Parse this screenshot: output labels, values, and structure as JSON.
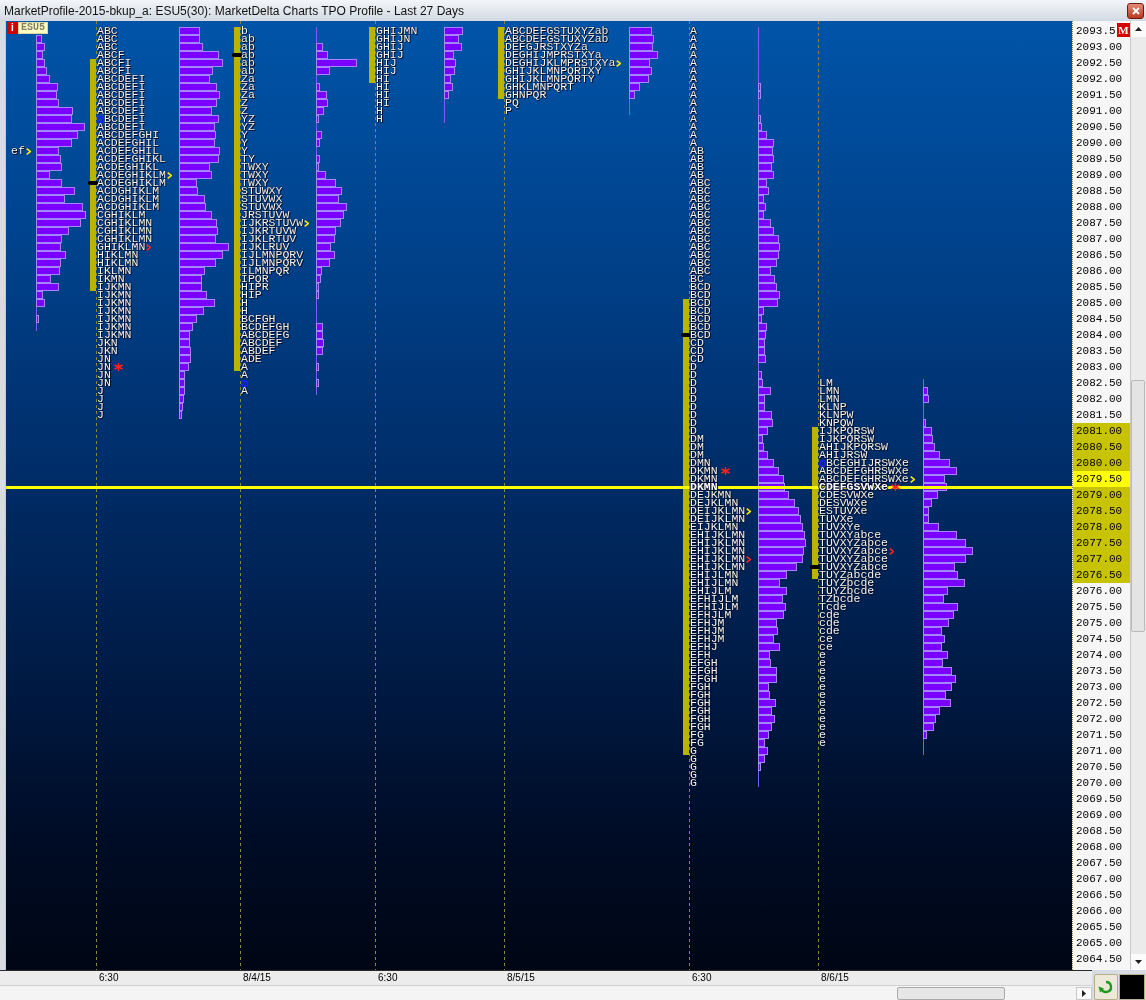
{
  "window": {
    "title": "MarketProfile-2015-bkup_a: ESU5(30): MarketDelta Charts TPO Profile - Last 27 Days"
  },
  "chart": {
    "info_badge": "i",
    "symbol": "ESU5",
    "sessions": [
      {
        "rows": [
          "ef"
        ]
      },
      {
        "time_label": "6:30",
        "rows": [
          "ABC",
          "ABC",
          "ABC",
          "ABCF",
          "ABCFI",
          "ABCFI",
          "ABCDEFI",
          "ABCDEFI",
          "ABCDEFI",
          "ABCDEFI",
          "ABCDEFI",
          "BCDEFI",
          "ABCDEFI",
          "ABCDEFGHI",
          "ACDEFGHIL",
          "ACDEFGHIL",
          "ACDEFGHIKL",
          "ACDEGHIKL",
          "ACDEGHIKLM",
          "ACDEGHIKLM",
          "ACDGHIKLM",
          "ACDGHIKLM",
          "ACDGHIKLM",
          "CGHIKLM",
          "CGHIKLMN",
          "CGHIKLMN",
          "CGHIKLMN",
          "GHIKLMN",
          "HIKLMN",
          "HIKLMN",
          "IKLMN",
          "IKMN",
          "IJKMN",
          "IJKMN",
          "IJKMN",
          "IJKMN",
          "IJKMN",
          "IJKMN",
          "IJKMN",
          "JKN",
          "JKN",
          "JN",
          "JN",
          "JN",
          "JN",
          "J",
          "J",
          "J",
          "J"
        ]
      },
      {
        "time_label": "8/4/15",
        "rows": [
          "b",
          "ab",
          "ab",
          "ab",
          "ab",
          "ab",
          "Za",
          "Za",
          "Za",
          "Z",
          "Z",
          "YZ",
          "YZ",
          "Y",
          "Y",
          "Y",
          "TY",
          "TWXY",
          "TWXY",
          "TWXY",
          "STUWXY",
          "STUVWX",
          "STUVWX",
          "JRSTUVW",
          "IJKRSTUVW",
          "IJKRTUVW",
          "IJKLRTUV",
          "IJKLRUV",
          "IJLMNPQRV",
          "IJLMNPQRV",
          "ILMNPQR",
          "IPQR",
          "HIPR",
          "HIP",
          "H",
          "H",
          "BCFGH",
          "BCDEFGH",
          "ABCDEFG",
          "ABCDEF",
          "ABDEF",
          "ADE",
          "A",
          "A",
          null,
          "A"
        ]
      },
      {
        "time_label": "6:30",
        "rows": [
          "GHIJMN",
          "GHIJN",
          "GHIJ",
          "GHIJ",
          "HIJ",
          "HIJ",
          "HI",
          "HI",
          "HI",
          "HI",
          "H",
          "H"
        ]
      },
      {
        "time_label": "8/5/15",
        "rows": [
          "ABCDEFGSTUXYZab",
          "ABCDEFGSTUXYZab",
          "DEFGJRSTXYZa",
          "DEGHIJMPRSTXYa",
          "DEGHIJKLMPRSTXYa",
          "GHIJKLMNPQRTXY",
          "GHIJKLMNPQRTY",
          "GHKLMNPQRT",
          "GHNPQR",
          "PQ",
          "P"
        ]
      },
      {
        "time_label": "6:30",
        "rows": [
          "A",
          "A",
          "A",
          "A",
          "A",
          "A",
          "A",
          "A",
          "A",
          "A",
          "A",
          "A",
          "A",
          "A",
          "A",
          "AB",
          "AB",
          "AB",
          "AB",
          "ABC",
          "ABC",
          "ABC",
          "ABC",
          "ABC",
          "ABC",
          "ABC",
          "ABC",
          "ABC",
          "ABC",
          "ABC",
          "ABC",
          "BC",
          "BCD",
          "BCD",
          "BCD",
          "BCD",
          "BCD",
          "BCD",
          "BCD",
          "CD",
          "CD",
          "CD",
          "D",
          "D",
          "D",
          "D",
          "D",
          "D",
          "D",
          "D",
          "D",
          "DM",
          "DM",
          "DM",
          "DMN",
          "DKMN",
          "DKMN",
          "DKMN",
          "DEJKMN",
          "DEJKLMN",
          "DEIJKLMN",
          "DEIJKLMN",
          "EIJKLMN",
          "EHIJKLMN",
          "EHIJKLMN",
          "EHIJKLMN",
          "EHIJKLMN",
          "EHIJKLMN",
          "EHIJLMN",
          "EHIJLMN",
          "EHIJLM",
          "EFHIJLM",
          "EFHIJLM",
          "EFHJLM",
          "EFHJM",
          "EFHJM",
          "EFHJM",
          "EFHJ",
          "EFH",
          "EFGH",
          "EFGH",
          "EFGH",
          "FGH",
          "FGH",
          "FGH",
          "FGH",
          "FGH",
          "FGH",
          "FG",
          "FG",
          "G",
          "G",
          "G",
          "G",
          "G"
        ]
      },
      {
        "time_label": "8/6/15",
        "rows": [
          "LM",
          "LMN",
          "LMN",
          "KLNP",
          "KLNPW",
          "KNPQW",
          "IJKPQRSW",
          "IJKPQRSW",
          "AHIJKPQRSW",
          "AHIJRSW",
          "BCEGHIJRSWXe",
          "ABCDEFGHRSWXe",
          "ABCDEFGHRSWXe",
          "CDEFGSVWXe",
          "CDESVWXe",
          "DESVWXe",
          "ESTUVXe",
          "TUVXe",
          "TUVXYe",
          "TUVXYabce",
          "TUVXYZabce",
          "TUVXYZabce",
          "TUVXYZabce",
          "TUVXYZabce",
          "TUYZabcde",
          "TUYZbcde",
          "TUYZbcde",
          "TZbcde",
          "Tcde",
          "cde",
          "cde",
          "cde",
          "ce",
          "ce",
          "e",
          "e",
          "e",
          "e",
          "e",
          "e",
          "e",
          "e",
          "e",
          "e",
          "e",
          "e"
        ]
      }
    ]
  },
  "price_axis": {
    "mode_badge": "M",
    "labels": [
      {
        "label": "2093.5",
        "in_value_area": false,
        "current": false
      },
      {
        "label": "2093.00",
        "in_value_area": false,
        "current": false
      },
      {
        "label": "2092.50",
        "in_value_area": false,
        "current": false
      },
      {
        "label": "2092.00",
        "in_value_area": false,
        "current": false
      },
      {
        "label": "2091.50",
        "in_value_area": false,
        "current": false
      },
      {
        "label": "2091.00",
        "in_value_area": false,
        "current": false
      },
      {
        "label": "2090.50",
        "in_value_area": false,
        "current": false
      },
      {
        "label": "2090.00",
        "in_value_area": false,
        "current": false
      },
      {
        "label": "2089.50",
        "in_value_area": false,
        "current": false
      },
      {
        "label": "2089.00",
        "in_value_area": false,
        "current": false
      },
      {
        "label": "2088.50",
        "in_value_area": false,
        "current": false
      },
      {
        "label": "2088.00",
        "in_value_area": false,
        "current": false
      },
      {
        "label": "2087.50",
        "in_value_area": false,
        "current": false
      },
      {
        "label": "2087.00",
        "in_value_area": false,
        "current": false
      },
      {
        "label": "2086.50",
        "in_value_area": false,
        "current": false
      },
      {
        "label": "2086.00",
        "in_value_area": false,
        "current": false
      },
      {
        "label": "2085.50",
        "in_value_area": false,
        "current": false
      },
      {
        "label": "2085.00",
        "in_value_area": false,
        "current": false
      },
      {
        "label": "2084.50",
        "in_value_area": false,
        "current": false
      },
      {
        "label": "2084.00",
        "in_value_area": false,
        "current": false
      },
      {
        "label": "2083.50",
        "in_value_area": false,
        "current": false
      },
      {
        "label": "2083.00",
        "in_value_area": false,
        "current": false
      },
      {
        "label": "2082.50",
        "in_value_area": false,
        "current": false
      },
      {
        "label": "2082.00",
        "in_value_area": false,
        "current": false
      },
      {
        "label": "2081.50",
        "in_value_area": false,
        "current": false
      },
      {
        "label": "2081.00",
        "in_value_area": true,
        "current": false
      },
      {
        "label": "2080.50",
        "in_value_area": true,
        "current": false
      },
      {
        "label": "2080.00",
        "in_value_area": true,
        "current": false
      },
      {
        "label": "2079.50",
        "in_value_area": true,
        "current": true
      },
      {
        "label": "2079.00",
        "in_value_area": true,
        "current": false
      },
      {
        "label": "2078.50",
        "in_value_area": true,
        "current": false
      },
      {
        "label": "2078.00",
        "in_value_area": true,
        "current": false
      },
      {
        "label": "2077.50",
        "in_value_area": true,
        "current": false
      },
      {
        "label": "2077.00",
        "in_value_area": true,
        "current": false
      },
      {
        "label": "2076.50",
        "in_value_area": true,
        "current": false
      },
      {
        "label": "2076.00",
        "in_value_area": false,
        "current": false
      },
      {
        "label": "2075.50",
        "in_value_area": false,
        "current": false
      },
      {
        "label": "2075.00",
        "in_value_area": false,
        "current": false
      },
      {
        "label": "2074.50",
        "in_value_area": false,
        "current": false
      },
      {
        "label": "2074.00",
        "in_value_area": false,
        "current": false
      },
      {
        "label": "2073.50",
        "in_value_area": false,
        "current": false
      },
      {
        "label": "2073.00",
        "in_value_area": false,
        "current": false
      },
      {
        "label": "2072.50",
        "in_value_area": false,
        "current": false
      },
      {
        "label": "2072.00",
        "in_value_area": false,
        "current": false
      },
      {
        "label": "2071.50",
        "in_value_area": false,
        "current": false
      },
      {
        "label": "2071.00",
        "in_value_area": false,
        "current": false
      },
      {
        "label": "2070.50",
        "in_value_area": false,
        "current": false
      },
      {
        "label": "2070.00",
        "in_value_area": false,
        "current": false
      },
      {
        "label": "2069.50",
        "in_value_area": false,
        "current": false
      },
      {
        "label": "2069.00",
        "in_value_area": false,
        "current": false
      },
      {
        "label": "2068.50",
        "in_value_area": false,
        "current": false
      },
      {
        "label": "2068.00",
        "in_value_area": false,
        "current": false
      },
      {
        "label": "2067.50",
        "in_value_area": false,
        "current": false
      },
      {
        "label": "2067.00",
        "in_value_area": false,
        "current": false
      },
      {
        "label": "2066.50",
        "in_value_area": false,
        "current": false
      },
      {
        "label": "2066.00",
        "in_value_area": false,
        "current": false
      },
      {
        "label": "2065.50",
        "in_value_area": false,
        "current": false
      },
      {
        "label": "2065.00",
        "in_value_area": false,
        "current": false
      },
      {
        "label": "2064.50",
        "in_value_area": false,
        "current": false
      }
    ]
  }
}
